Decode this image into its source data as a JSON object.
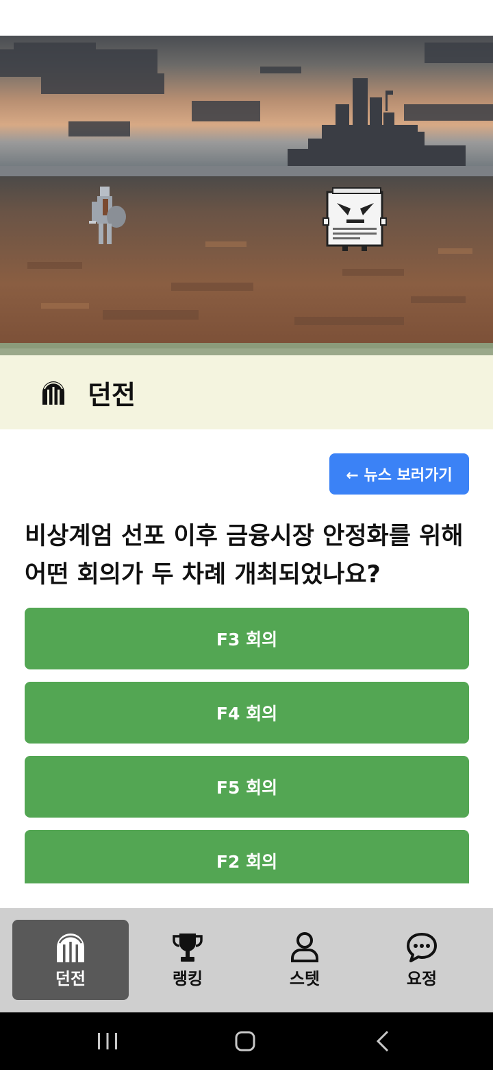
{
  "header": {
    "title": "던전",
    "icon": "dungeon-gate-icon"
  },
  "content": {
    "back_button": "← 뉴스 보러가기",
    "question": "비상계엄 선포 이후 금융시장 안정화를 위해 어떤 회의가 두 차례 개최되었나요?",
    "answers": [
      "F3 회의",
      "F4 회의",
      "F5 회의",
      "F2 회의"
    ]
  },
  "bottom_nav": {
    "items": [
      {
        "label": "던전",
        "icon": "dungeon-gate-icon",
        "active": true
      },
      {
        "label": "랭킹",
        "icon": "trophy-icon",
        "active": false
      },
      {
        "label": "스텟",
        "icon": "person-icon",
        "active": false
      },
      {
        "label": "요정",
        "icon": "chat-bubble-icon",
        "active": false
      }
    ]
  },
  "system_nav": {
    "icons": [
      "recent-apps-icon",
      "home-icon",
      "back-icon"
    ]
  },
  "colors": {
    "header_bg": "#f4f4df",
    "back_button": "#3b82f6",
    "answer_button": "#53a653",
    "nav_bg": "#cfcfcf",
    "nav_active": "#595959"
  }
}
